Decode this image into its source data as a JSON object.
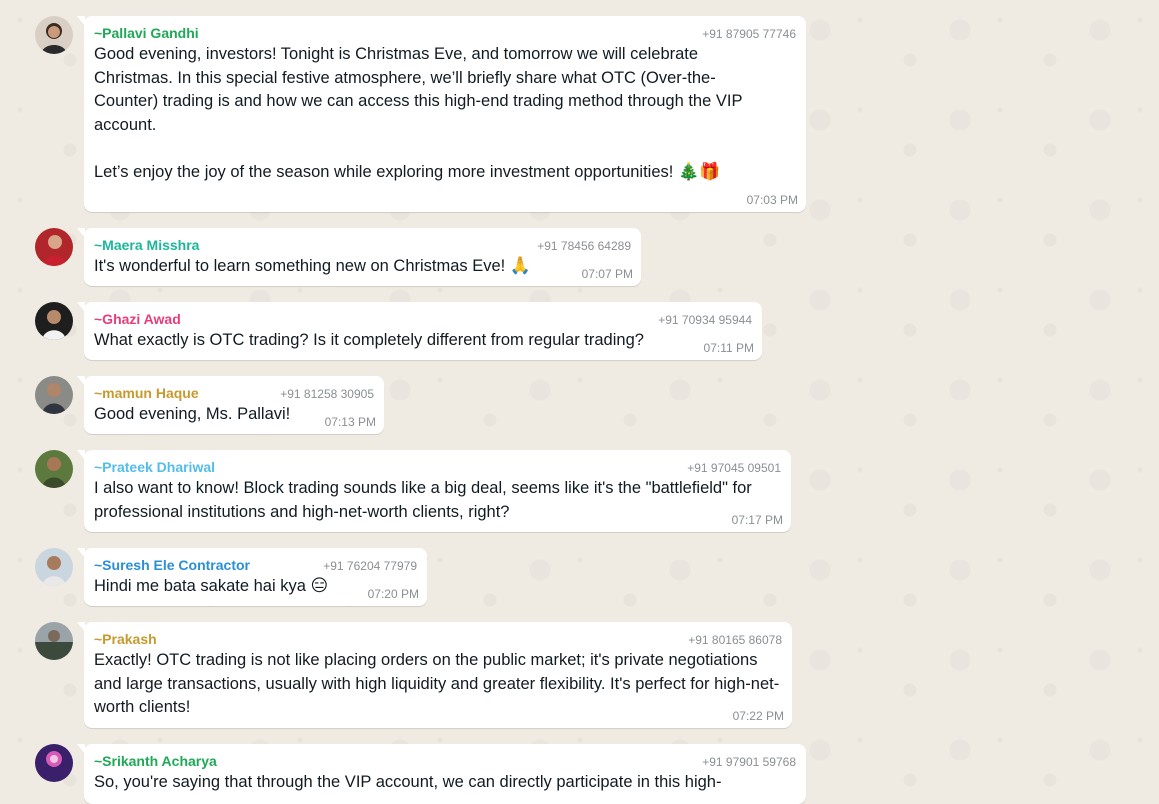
{
  "chat": {
    "messages": [
      {
        "sender": "~Pallavi Gandhi",
        "sender_color": "#1fa855",
        "phone": "+91 87905 77746",
        "text": "Good evening, investors! Tonight is Christmas Eve, and tomorrow we will celebrate Christmas. In this special festive atmosphere, we’ll briefly share what OTC (Over-the-Counter) trading is and how we can access this high-end trading method through the VIP account.\n\nLet’s enjoy the joy of the season while exploring more investment opportunities!",
        "emoji": "🎄🎁",
        "time": "07:03 PM"
      },
      {
        "sender": "~Maera Misshra",
        "sender_color": "#1cb79a",
        "phone": "+91 78456 64289",
        "text": "It's wonderful to learn something new on Christmas Eve!",
        "emoji": "🙏",
        "time": "07:07 PM"
      },
      {
        "sender": "~Ghazi Awad",
        "sender_color": "#e53e7a",
        "phone": "+91 70934 95944",
        "text": "What exactly is OTC trading? Is it completely different from regular trading?",
        "time": "07:11 PM"
      },
      {
        "sender": "~mamun Haque",
        "sender_color": "#c79a2e",
        "phone": "+91 81258 30905",
        "text": "Good evening, Ms. Pallavi!",
        "time": "07:13 PM"
      },
      {
        "sender": "~Prateek Dhariwal",
        "sender_color": "#53bdeb",
        "phone": "+91 97045 09501",
        "text": "I also want to know! Block trading sounds like a big deal, seems like it's the \"battlefield\" for professional institutions and high-net-worth clients, right?",
        "time": "07:17 PM"
      },
      {
        "sender": "~Suresh Ele Contractor",
        "sender_color": "#2a8fd6",
        "phone": "+91 76204 77979",
        "text": "Hindi me bata sakate hai kya",
        "emoji": "😑",
        "time": "07:20 PM"
      },
      {
        "sender": "~Prakash",
        "sender_color": "#c79a2e",
        "phone": "+91 80165 86078",
        "text": "Exactly! OTC trading is not like placing orders on the public market; it's private negotiations and large transactions, usually with high liquidity and greater flexibility. It's perfect for high-net-worth clients!",
        "time": "07:22 PM"
      },
      {
        "sender": "~Srikanth Acharya",
        "sender_color": "#1fa855",
        "phone": "+91 97901 59768",
        "text": "So, you're saying that through the VIP account, we can directly participate in this high-",
        "time": ""
      }
    ]
  }
}
